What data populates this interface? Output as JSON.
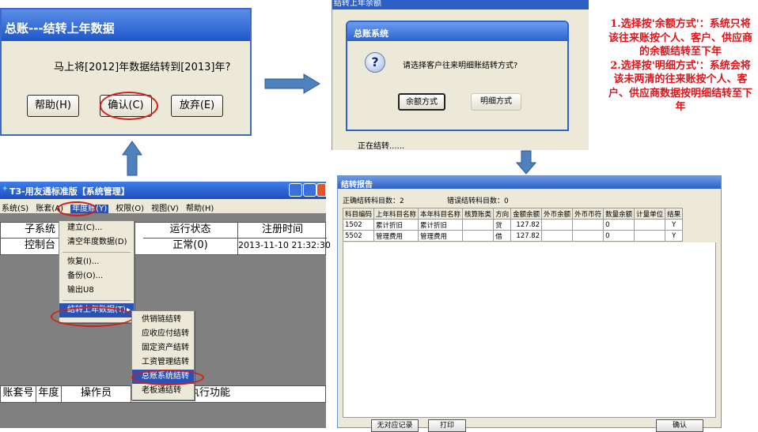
{
  "dialog1": {
    "title": "总账---结转上年数据",
    "message": "马上将[2012]年数据结转到[2013]年?",
    "buttons": [
      "帮助(H)",
      "确认(C)",
      "放弃(E)"
    ]
  },
  "dialog2": {
    "window_title": "结转上年余额",
    "title": "总账系统",
    "question": "请选择客户往来明细账结转方式?",
    "buttons": [
      "余额方式",
      "明细方式"
    ],
    "status": "正在结转......"
  },
  "note": {
    "line1": "1.选择按'余额方式'：系统只将该往来账按个人、客户、供应商的余额结转至下年",
    "line2": "2.选择按'明细方式'：系统会将该未两清的往来账按个人、客户、供应商数据按明细结转至下年"
  },
  "app": {
    "title": "T3-用友通标准版【系统管理】",
    "menu": [
      "系统(S)",
      "账套(A)",
      "年度账(Y)",
      "权限(O)",
      "视图(V)",
      "帮助(H)"
    ],
    "top_headers": [
      "子系统",
      "运行状态",
      "注册时间"
    ],
    "top_row": [
      "控制台",
      "正常(0)",
      "2013-11-10 21:32:30"
    ],
    "bottom_headers": [
      "账套号",
      "年度",
      "操作员",
      "执行功能"
    ],
    "dropdown": [
      "建立(C)...",
      "清空年度数据(D)",
      "恢复(I)...",
      "备份(O)...",
      "输出U8",
      "结转上年数据(T)"
    ],
    "submenu": [
      "供销链结转",
      "应收应付结转",
      "固定资产结转",
      "工资管理结转",
      "总账系统结转",
      "老板通结转"
    ]
  },
  "report": {
    "title": "结转报告",
    "correct_label": "正确结转科目数：",
    "correct_count": "2",
    "error_label": "错误结转科目数：",
    "error_count": "0",
    "columns": [
      "科目编码",
      "上年科目名称",
      "本年科目名称",
      "核算账类",
      "方向",
      "金额余额",
      "外币余额",
      "外币币符",
      "数量余额",
      "计量单位",
      "结果"
    ],
    "rows": [
      [
        "1502",
        "累计折旧",
        "累计折旧",
        "",
        "贷",
        "127.82",
        "",
        "",
        "0",
        "",
        "Y"
      ],
      [
        "5502",
        "管理费用",
        "管理费用",
        "",
        "借",
        "127.82",
        "",
        "",
        "0",
        "",
        "Y"
      ]
    ],
    "buttons": [
      "无对应记录",
      "打印",
      "确认"
    ]
  },
  "colors": {
    "accent_red": "#e0141b",
    "xp_blue": "#2b63d0",
    "arrow_blue": "#4f81bd"
  }
}
